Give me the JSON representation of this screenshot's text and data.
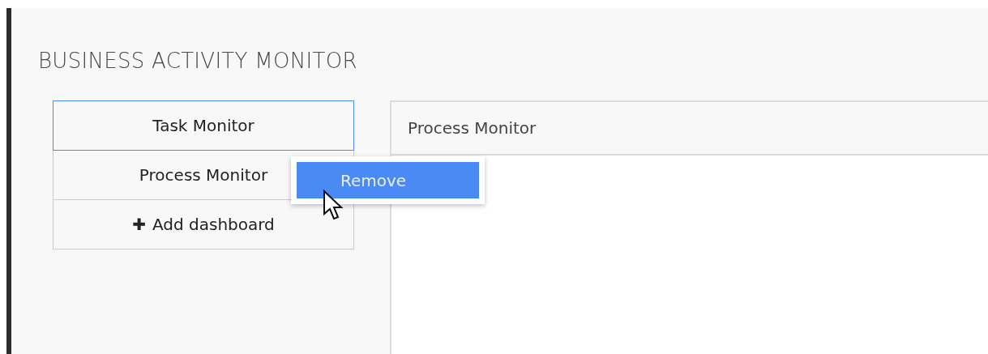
{
  "title": "BUSINESS ACTIVITY MONITOR",
  "dashboards": [
    {
      "label": "Task Monitor",
      "selected": true
    },
    {
      "label": "Process Monitor",
      "selected": false
    }
  ],
  "add_button": {
    "icon": "✚",
    "label": "Add dashboard"
  },
  "panel": {
    "title": "Process Monitor"
  },
  "context_menu": {
    "items": [
      {
        "label": "Remove",
        "selected": true
      }
    ]
  }
}
